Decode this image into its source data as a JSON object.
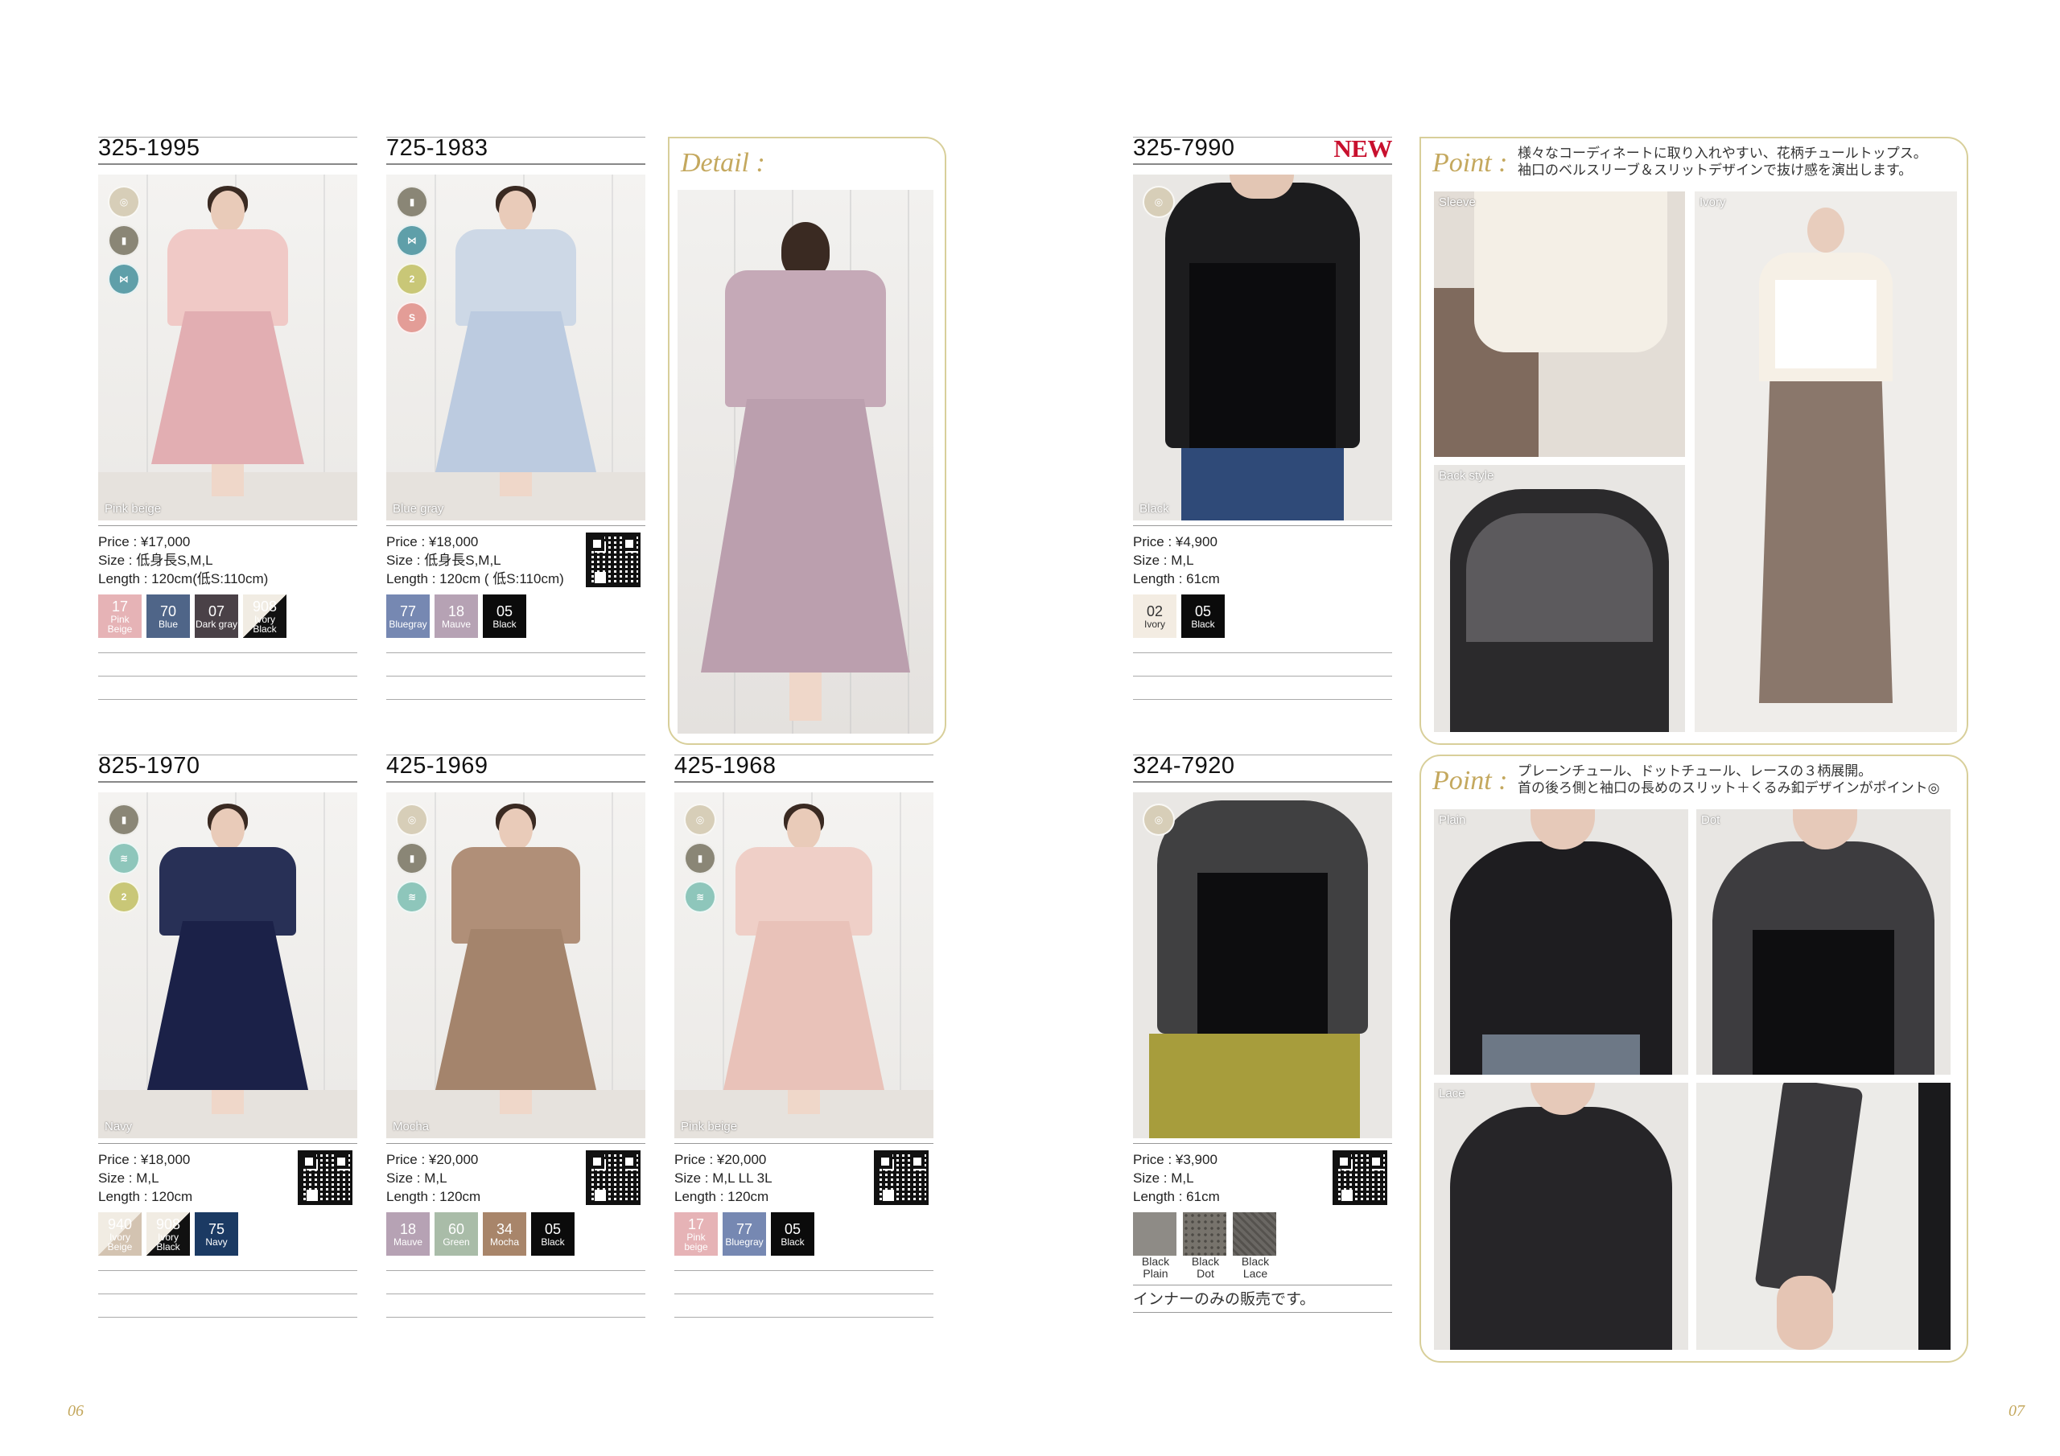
{
  "left_page": {
    "page_number": "06",
    "cards": [
      {
        "code": "325-1995",
        "photo_label": "Pink beige",
        "price": "Price : ¥17,000",
        "size": "Size : 低身長S,M,L",
        "length": "Length : 120cm(低S:110cm)",
        "has_qr": false,
        "colors": [
          {
            "num": "17",
            "name": "Pink Beige",
            "hex": "#e6b3b6"
          },
          {
            "num": "70",
            "name": "Blue",
            "hex": "#4f6588"
          },
          {
            "num": "07",
            "name": "Dark gray",
            "hex": "#4a4147"
          },
          {
            "num": "908",
            "name": "Ivory Black",
            "hex": "#111111"
          }
        ]
      },
      {
        "code": "725-1983",
        "photo_label": "Blue gray",
        "price": "Price : ¥18,000",
        "size": "Size : 低身長S,M,L",
        "length": "Length : 120cm ( 低S:110cm)",
        "has_qr": true,
        "colors": [
          {
            "num": "77",
            "name": "Bluegray",
            "hex": "#7688b2"
          },
          {
            "num": "18",
            "name": "Mauve",
            "hex": "#b6a2b4"
          },
          {
            "num": "05",
            "name": "Black",
            "hex": "#0b0b0b"
          }
        ]
      },
      {
        "code": "825-1970",
        "photo_label": "Navy",
        "price": "Price : ¥18,000",
        "size": "Size : M,L",
        "length": "Length : 120cm",
        "has_qr": true,
        "colors": [
          {
            "num": "940",
            "name": "Ivory Beige",
            "hex": "#e4dcd3"
          },
          {
            "num": "908",
            "name": "Ivory Black",
            "hex": "#111111"
          },
          {
            "num": "75",
            "name": "Navy",
            "hex": "#1b3a63"
          }
        ]
      },
      {
        "code": "425-1969",
        "photo_label": "Mocha",
        "price": "Price : ¥20,000",
        "size": "Size : M,L",
        "length": "Length : 120cm",
        "has_qr": true,
        "colors": [
          {
            "num": "18",
            "name": "Mauve",
            "hex": "#b6a2b4"
          },
          {
            "num": "60",
            "name": "Green",
            "hex": "#a9bca8"
          },
          {
            "num": "34",
            "name": "Mocha",
            "hex": "#a8856a"
          },
          {
            "num": "05",
            "name": "Black",
            "hex": "#0b0b0b"
          }
        ]
      },
      {
        "code": "425-1968",
        "photo_label": "Pink beige",
        "price": "Price : ¥20,000",
        "size": "Size : M,L LL 3L",
        "length": "Length : 120cm",
        "has_qr": true,
        "colors": [
          {
            "num": "17",
            "name": "Pink beige",
            "hex": "#e6b3b6"
          },
          {
            "num": "77",
            "name": "Bluegray",
            "hex": "#7688b2"
          },
          {
            "num": "05",
            "name": "Black",
            "hex": "#0b0b0b"
          }
        ]
      }
    ],
    "detail_panel": {
      "title": "Detail :"
    }
  },
  "right_page": {
    "page_number": "07",
    "cards": [
      {
        "code": "325-7990",
        "badge": "NEW",
        "photo_label": "Black",
        "price": "Price : ¥4,900",
        "size": "Size : M,L",
        "length": "Length : 61cm",
        "has_qr": false,
        "colors": [
          {
            "num": "02",
            "name": "Ivory",
            "hex": "#f3ece2"
          },
          {
            "num": "05",
            "name": "Black",
            "hex": "#0b0b0b"
          }
        ]
      },
      {
        "code": "324-7920",
        "photo_label": "",
        "price": "Price : ¥3,900",
        "size": "Size : M,L",
        "length": "Length : 61cm",
        "has_qr": true,
        "colors": [
          {
            "num": "",
            "name": "Black Plain",
            "hex": "#8e8b86"
          },
          {
            "num": "",
            "name": "Black Dot",
            "hex": "#77736c"
          },
          {
            "num": "",
            "name": "Black Lace",
            "hex": "#6a6763"
          }
        ],
        "note": "インナーのみの販売です。"
      }
    ],
    "point_panel_1": {
      "title": "Point :",
      "desc_line1": "様々なコーディネートに取り入れやすい、花柄チュールトップス。",
      "desc_line2": "袖口のベルスリーブ＆スリットデザインで抜け感を演出します。",
      "labels": [
        "Sleeve",
        "Ivory",
        "Back style"
      ]
    },
    "point_panel_2": {
      "title": "Point :",
      "desc_line1": "プレーンチュール、ドットチュール、レースの３柄展開。",
      "desc_line2": "首の後ろ側と袖口の長めのスリット＋くるみ釦デザインがポイント◎",
      "labels": [
        "Plain",
        "Dot",
        "Lace"
      ]
    }
  },
  "colors": {
    "accent_gold": "#c4a85e",
    "panel_border": "#d8cf9a",
    "new_red": "#c8102e"
  }
}
